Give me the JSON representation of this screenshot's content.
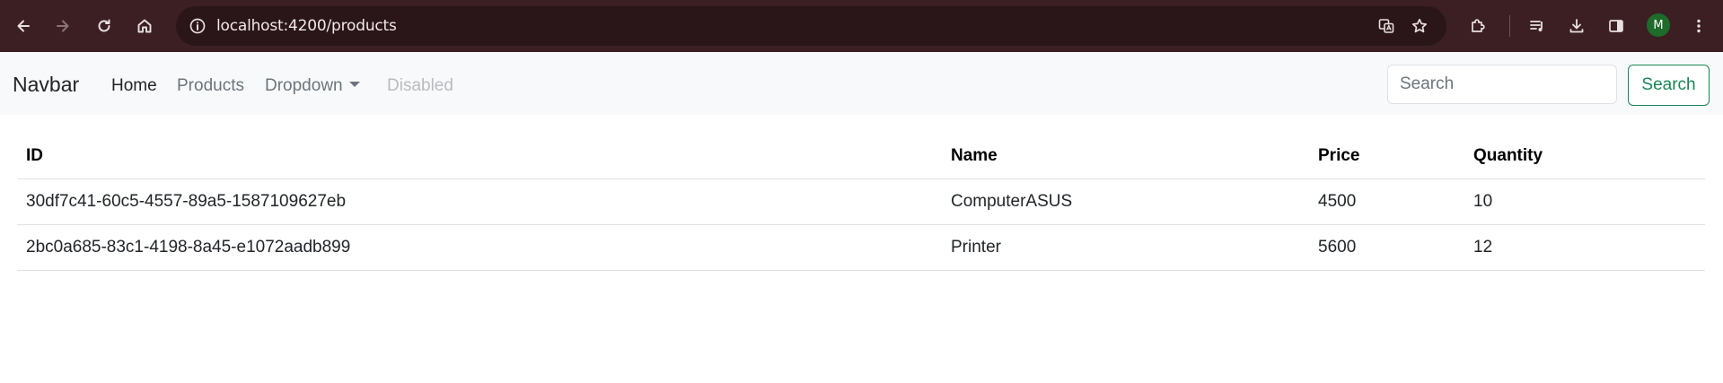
{
  "browser": {
    "url": "localhost:4200/products",
    "profile_initial": "M",
    "accent": "#3b1f23",
    "avatar_color": "#1e6b2a"
  },
  "navbar": {
    "brand": "Navbar",
    "links": {
      "home": "Home",
      "products": "Products",
      "dropdown": "Dropdown",
      "disabled": "Disabled"
    },
    "search_placeholder": "Search",
    "search_button": "Search",
    "search_button_color": "#198754"
  },
  "table": {
    "headers": [
      "ID",
      "Name",
      "Price",
      "Quantity"
    ],
    "rows": [
      [
        "30df7c41-60c5-4557-89a5-1587109627eb",
        "ComputerASUS",
        "4500",
        "10"
      ],
      [
        "2bc0a685-83c1-4198-8a45-e1072aadb899",
        "Printer",
        "5600",
        "12"
      ]
    ]
  }
}
